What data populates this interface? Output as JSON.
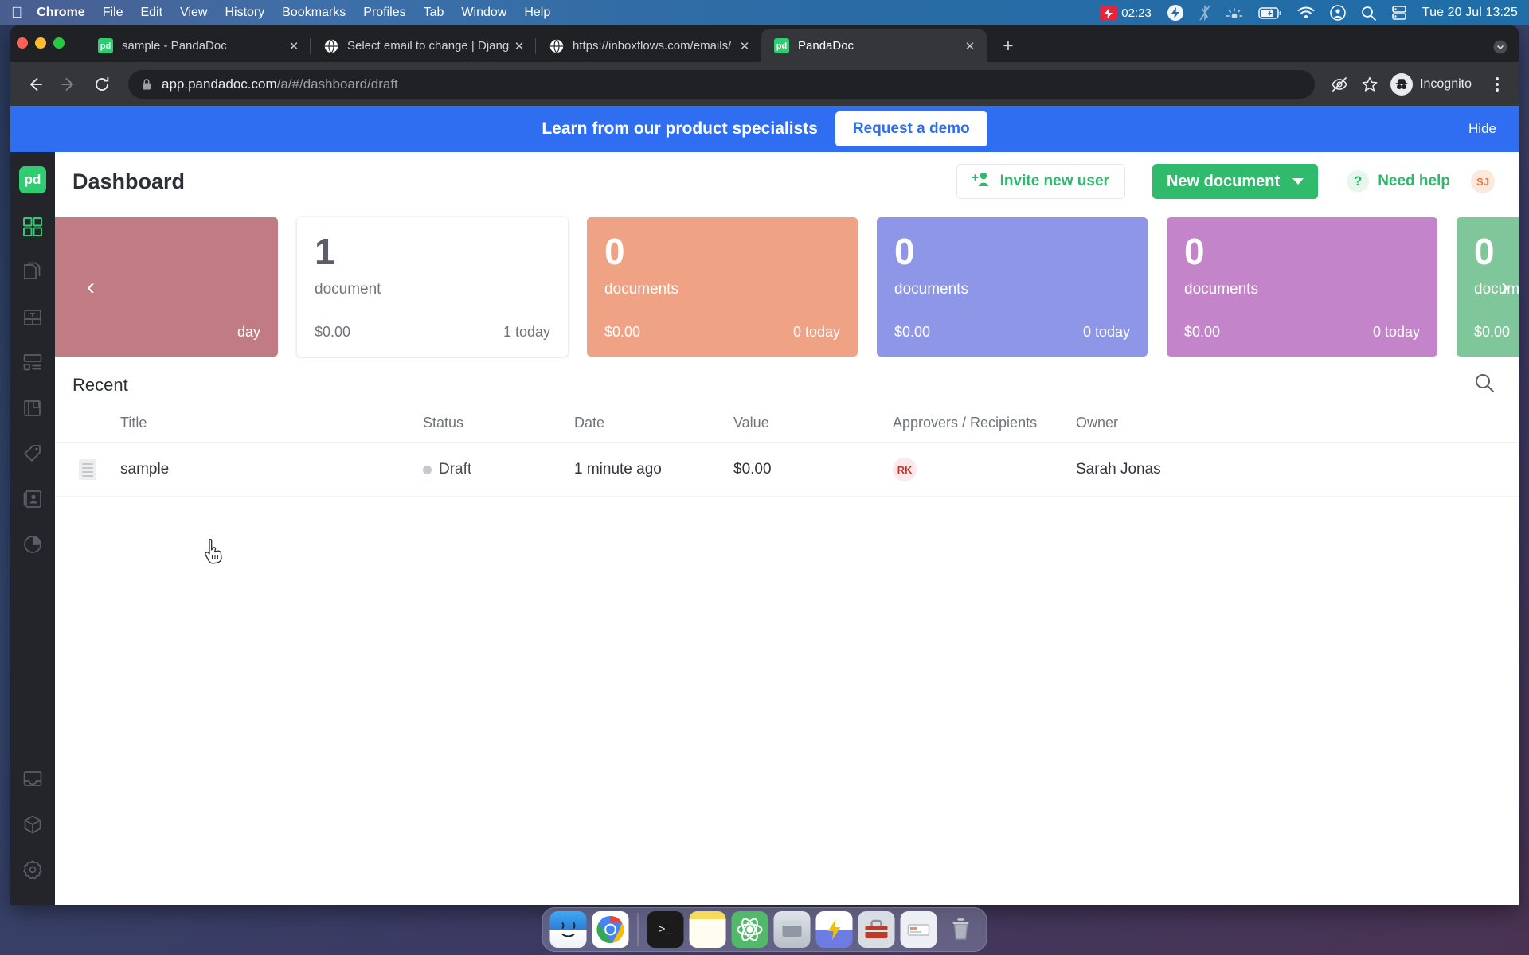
{
  "menubar": {
    "apple_icon": "apple-icon",
    "items": [
      {
        "label": "Chrome",
        "bold": true
      },
      {
        "label": "File",
        "bold": false
      },
      {
        "label": "Edit",
        "bold": false
      },
      {
        "label": "View",
        "bold": false
      },
      {
        "label": "History",
        "bold": false
      },
      {
        "label": "Bookmarks",
        "bold": false
      },
      {
        "label": "Profiles",
        "bold": false
      },
      {
        "label": "Tab",
        "bold": false
      },
      {
        "label": "Window",
        "bold": false
      },
      {
        "label": "Help",
        "bold": false
      }
    ],
    "recording_time": "02:23",
    "status_icons": [
      "thunderbolt-icon",
      "bluetooth-off-icon",
      "brightness-icon",
      "battery-charging-icon",
      "wifi-icon",
      "control-center-icon",
      "search-icon",
      "display-icon"
    ],
    "clock": "Tue 20 Jul  13:25"
  },
  "browser": {
    "tabs": [
      {
        "title": "sample - PandaDoc",
        "favicon": "pandadoc-icon",
        "active": false
      },
      {
        "title": "Select email to change | Djang",
        "favicon": "globe-icon",
        "active": false
      },
      {
        "title": "https://inboxflows.com/emails/",
        "favicon": "globe-icon",
        "active": false
      },
      {
        "title": "PandaDoc",
        "favicon": "pandadoc-icon",
        "active": true
      }
    ],
    "new_tab_label": "+",
    "close_label": "✕",
    "url_host": "app.pandadoc.com",
    "url_path": "/a/#/dashboard/draft",
    "profile_label": "Incognito",
    "toolbar_icons": [
      "back-icon",
      "forward-icon",
      "reload-icon",
      "lock-icon",
      "eye-slash-icon",
      "bookmark-star-icon",
      "incognito-icon",
      "kebab-menu-icon"
    ]
  },
  "promo": {
    "text": "Learn from our product specialists",
    "cta": "Request a demo",
    "hide": "Hide"
  },
  "sidebar": {
    "logo": "pandadoc-logo",
    "items": [
      {
        "name": "dashboard",
        "icon": "grid-icon",
        "active": true
      },
      {
        "name": "documents",
        "icon": "documents-icon",
        "active": false
      },
      {
        "name": "templates",
        "icon": "template-icon",
        "active": false
      },
      {
        "name": "content-library",
        "icon": "content-library-icon",
        "active": false
      },
      {
        "name": "catalog",
        "icon": "catalog-icon",
        "active": false
      },
      {
        "name": "pricing",
        "icon": "tag-icon",
        "active": false
      },
      {
        "name": "contacts",
        "icon": "contacts-icon",
        "active": false
      },
      {
        "name": "reports",
        "icon": "pie-chart-icon",
        "active": false
      }
    ],
    "bottom_items": [
      {
        "name": "inbox",
        "icon": "inbox-icon"
      },
      {
        "name": "integrations",
        "icon": "cube-icon"
      },
      {
        "name": "settings",
        "icon": "gear-icon"
      }
    ]
  },
  "header": {
    "title": "Dashboard",
    "invite_label": "Invite new user",
    "new_document_label": "New document",
    "need_help_label": "Need help",
    "help_badge": "?",
    "user_initials": "SJ"
  },
  "cards": {
    "prev_arrow": "‹",
    "next_arrow": "›",
    "items": [
      {
        "number": "",
        "label": "",
        "value": "",
        "today": "day",
        "color": "#c07c82",
        "tinted": true,
        "partial": true
      },
      {
        "number": "1",
        "label": "document",
        "value": "$0.00",
        "today": "1 today",
        "color": "#ffffff",
        "tinted": false,
        "partial": false
      },
      {
        "number": "0",
        "label": "documents",
        "value": "$0.00",
        "today": "0 today",
        "color": "#f0a285",
        "tinted": true,
        "partial": false
      },
      {
        "number": "0",
        "label": "documents",
        "value": "$0.00",
        "today": "0 today",
        "color": "#8e96e8",
        "tinted": true,
        "partial": false
      },
      {
        "number": "0",
        "label": "documents",
        "value": "$0.00",
        "today": "0 today",
        "color": "#c484c9",
        "tinted": true,
        "partial": false
      },
      {
        "number": "0",
        "label": "documents",
        "value": "$0.00",
        "today": "",
        "color": "#7fc69a",
        "tinted": true,
        "partial": true
      }
    ]
  },
  "recent": {
    "title": "Recent",
    "search_icon": "search-icon",
    "columns": [
      "Title",
      "Status",
      "Date",
      "Value",
      "Approvers / Recipients",
      "Owner"
    ],
    "rows": [
      {
        "icon": "document-icon",
        "title": "sample",
        "status": "Draft",
        "date": "1 minute ago",
        "value": "$0.00",
        "approver": "RK",
        "owner": "Sarah Jonas"
      }
    ]
  },
  "dock": {
    "apps": [
      {
        "name": "finder",
        "glyph": "🙂",
        "bg": "#2fa1e8",
        "running": true
      },
      {
        "name": "chrome",
        "glyph": "",
        "bg": "#ffffff",
        "running": true
      },
      {
        "name": "terminal",
        "glyph": ">_",
        "bg": "#1c1c1c",
        "running": true
      },
      {
        "name": "notes",
        "glyph": "",
        "bg": "#fdfdf6",
        "running": true
      },
      {
        "name": "atom",
        "glyph": "",
        "bg": "#4caf50",
        "running": true
      },
      {
        "name": "archive",
        "glyph": "",
        "bg": "#cfd3da",
        "running": false
      },
      {
        "name": "bolt-app",
        "glyph": "⚡",
        "bg": "#f4d03f",
        "running": false
      },
      {
        "name": "toolbox",
        "glyph": "🧰",
        "bg": "#c0392b",
        "running": false
      },
      {
        "name": "card-app",
        "glyph": "",
        "bg": "#e9ecef",
        "running": false
      },
      {
        "name": "trash",
        "glyph": "🗑",
        "bg": "#b7bcc4",
        "running": false
      }
    ]
  }
}
